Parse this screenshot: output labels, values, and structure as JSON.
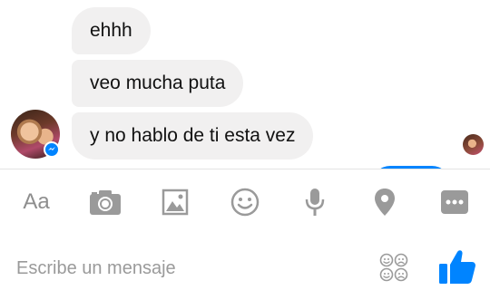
{
  "conversation": {
    "messages": [
      {
        "sender": "contact",
        "text": "ehhh"
      },
      {
        "sender": "contact",
        "text": "veo mucha puta"
      },
      {
        "sender": "contact",
        "text": "y no hablo de ti esta vez"
      }
    ]
  },
  "toolbar": {
    "text_style_label": "Aa",
    "icons": [
      "camera-icon",
      "gallery-icon",
      "emoji-icon",
      "microphone-icon",
      "location-icon",
      "more-icon"
    ]
  },
  "composer": {
    "placeholder": "Escribe un mensaje",
    "value": ""
  },
  "colors": {
    "accent": "#0084ff",
    "bubble_incoming": "#f1f0f0",
    "icon_gray": "#9a9a9a"
  }
}
